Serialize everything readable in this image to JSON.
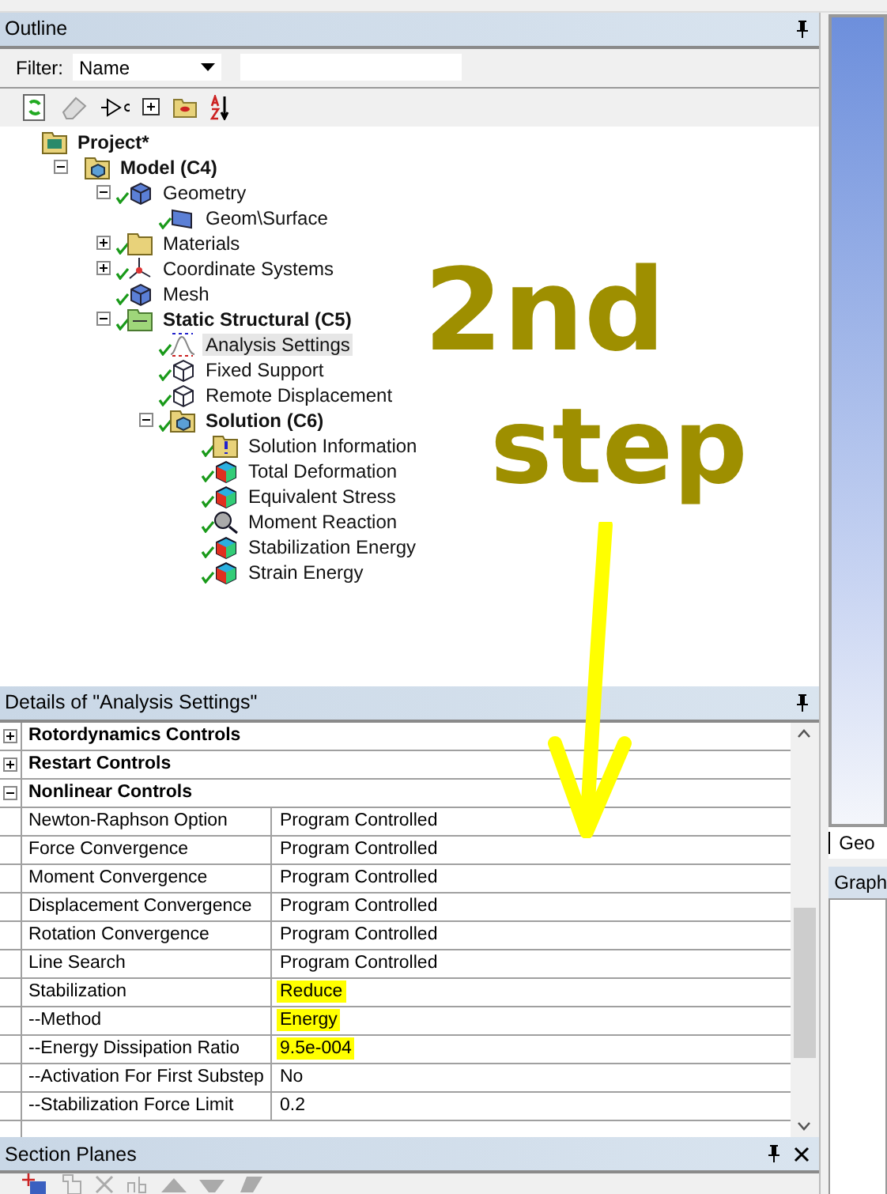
{
  "outline": {
    "title": "Outline",
    "filter_label": "Filter:",
    "filter_value": "Name",
    "tree": [
      {
        "label": "Project*",
        "kind": "project",
        "bold": true,
        "checked": false,
        "selected": false,
        "children": [
          {
            "label": "Model (C4)",
            "kind": "model",
            "bold": true,
            "checked": false,
            "selected": false,
            "expanded": true,
            "children": [
              {
                "label": "Geometry",
                "kind": "geometry",
                "bold": false,
                "checked": true,
                "selected": false,
                "expanded": true,
                "children": [
                  {
                    "label": "Geom\\Surface",
                    "kind": "surface",
                    "bold": false,
                    "checked": true,
                    "selected": false
                  }
                ]
              },
              {
                "label": "Materials",
                "kind": "materials",
                "bold": false,
                "checked": true,
                "selected": false,
                "expanded": false
              },
              {
                "label": "Coordinate Systems",
                "kind": "coordinates",
                "bold": false,
                "checked": true,
                "selected": false,
                "expanded": false
              },
              {
                "label": "Mesh",
                "kind": "mesh",
                "bold": false,
                "checked": true,
                "selected": false
              },
              {
                "label": "Static Structural (C5)",
                "kind": "analysis",
                "bold": true,
                "checked": true,
                "selected": false,
                "expanded": true,
                "children": [
                  {
                    "label": "Analysis Settings",
                    "kind": "settings",
                    "bold": false,
                    "checked": true,
                    "selected": true
                  },
                  {
                    "label": "Fixed Support",
                    "kind": "support",
                    "bold": false,
                    "checked": true,
                    "selected": false
                  },
                  {
                    "label": "Remote Displacement",
                    "kind": "support",
                    "bold": false,
                    "checked": true,
                    "selected": false
                  },
                  {
                    "label": "Solution (C6)",
                    "kind": "solution",
                    "bold": true,
                    "checked": true,
                    "selected": false,
                    "expanded": true,
                    "children": [
                      {
                        "label": "Solution Information",
                        "kind": "info",
                        "bold": false,
                        "checked": true,
                        "selected": false
                      },
                      {
                        "label": "Total Deformation",
                        "kind": "result",
                        "bold": false,
                        "checked": true,
                        "selected": false
                      },
                      {
                        "label": "Equivalent Stress",
                        "kind": "result",
                        "bold": false,
                        "checked": true,
                        "selected": false
                      },
                      {
                        "label": "Moment Reaction",
                        "kind": "probe",
                        "bold": false,
                        "checked": true,
                        "selected": false
                      },
                      {
                        "label": "Stabilization Energy",
                        "kind": "result",
                        "bold": false,
                        "checked": true,
                        "selected": false
                      },
                      {
                        "label": "Strain Energy",
                        "kind": "result",
                        "bold": false,
                        "checked": true,
                        "selected": false
                      }
                    ]
                  }
                ]
              }
            ]
          }
        ]
      }
    ]
  },
  "details": {
    "title": "Details of \"Analysis Settings\"",
    "groups": [
      {
        "label": "Rotordynamics Controls",
        "expanded": false
      },
      {
        "label": "Restart Controls",
        "expanded": false
      },
      {
        "label": "Nonlinear Controls",
        "expanded": true
      }
    ],
    "rows": [
      {
        "property": "Newton-Raphson Option",
        "value": "Program Controlled",
        "highlighted": false
      },
      {
        "property": "Force Convergence",
        "value": "Program Controlled",
        "highlighted": false
      },
      {
        "property": "Moment Convergence",
        "value": "Program Controlled",
        "highlighted": false
      },
      {
        "property": "Displacement Convergence",
        "value": "Program Controlled",
        "highlighted": false
      },
      {
        "property": "Rotation Convergence",
        "value": "Program Controlled",
        "highlighted": false
      },
      {
        "property": "Line Search",
        "value": "Program Controlled",
        "highlighted": false
      },
      {
        "property": "Stabilization",
        "value": "Reduce",
        "highlighted": true
      },
      {
        "property": "--Method",
        "value": "Energy",
        "highlighted": true
      },
      {
        "property": "--Energy Dissipation Ratio",
        "value": "9.5e-004",
        "highlighted": true
      },
      {
        "property": "--Activation For First Substep",
        "value": "No",
        "highlighted": false
      },
      {
        "property": "--Stabilization Force Limit",
        "value": "0.2",
        "highlighted": false
      }
    ]
  },
  "section_planes": {
    "title": "Section Planes"
  },
  "graphics": {
    "tab": "Geo",
    "panel_title": "Graph"
  },
  "annotation": {
    "lines": [
      "2nd",
      "step"
    ]
  }
}
